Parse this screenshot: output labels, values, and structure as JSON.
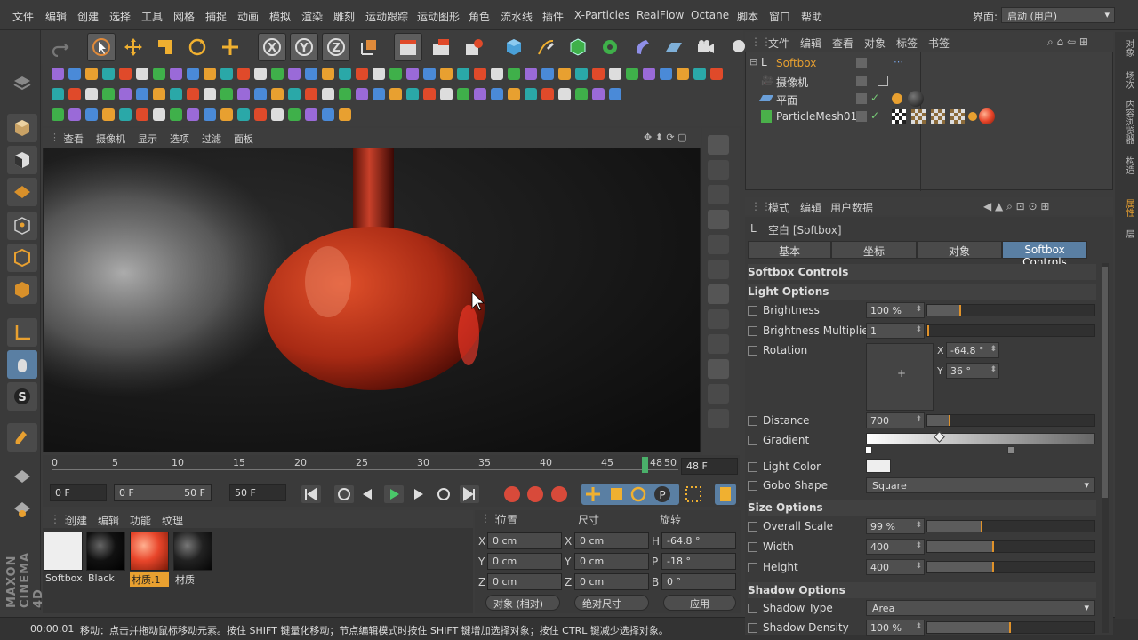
{
  "menu": [
    "文件",
    "编辑",
    "创建",
    "选择",
    "工具",
    "网格",
    "捕捉",
    "动画",
    "模拟",
    "渲染",
    "雕刻",
    "运动跟踪",
    "运动图形",
    "角色",
    "流水线",
    "插件",
    "X-Particles",
    "RealFlow",
    "Octane",
    "脚本",
    "窗口",
    "帮助"
  ],
  "layout": {
    "label": "界面:",
    "value": "启动 (用户)"
  },
  "viewport": {
    "menu": [
      "查看",
      "摄像机",
      "显示",
      "选项",
      "过滤",
      "面板"
    ]
  },
  "timeline": {
    "ticks": [
      "0",
      "5",
      "10",
      "15",
      "20",
      "25",
      "30",
      "35",
      "40",
      "45",
      "48",
      "50"
    ],
    "current": "48 F"
  },
  "transport": {
    "start": "0 F",
    "range_start": "0 F",
    "range_end": "50 F",
    "end": "50 F"
  },
  "materials": {
    "menu": [
      "创建",
      "编辑",
      "功能",
      "纹理"
    ],
    "items": [
      {
        "name": "Softbox",
        "color": "#eeeeee"
      },
      {
        "name": "Black",
        "color": "#111111"
      },
      {
        "name": "材质.1",
        "color": "#e8452a"
      },
      {
        "name": "材质",
        "color": "#222222"
      }
    ]
  },
  "coords": {
    "headers": [
      "位置",
      "尺寸",
      "旋转"
    ],
    "rows": [
      {
        "a": "X",
        "pos": "0 cm",
        "b": "X",
        "size": "0 cm",
        "c": "H",
        "rot": "-64.8 °"
      },
      {
        "a": "Y",
        "pos": "0 cm",
        "b": "Y",
        "size": "0 cm",
        "c": "P",
        "rot": "-18 °"
      },
      {
        "a": "Z",
        "pos": "0 cm",
        "b": "Z",
        "size": "0 cm",
        "c": "B",
        "rot": "0 °"
      }
    ],
    "mode": "对象 (相对)",
    "size_mode": "绝对尺寸",
    "apply": "应用"
  },
  "status": {
    "time": "00:00:01",
    "message": "移动：点击并拖动鼠标移动元素。按住 SHIFT 键量化移动；节点编辑模式时按住 SHIFT 键增加选择对象；按住 CTRL 键减少选择对象。"
  },
  "objects": {
    "menu": [
      "文件",
      "编辑",
      "查看",
      "对象",
      "标签",
      "书签"
    ],
    "items": [
      {
        "name": "Softbox",
        "highlight": true
      },
      {
        "name": "摄像机",
        "highlight": false
      },
      {
        "name": "平面",
        "highlight": false
      },
      {
        "name": "ParticleMesh01",
        "highlight": false
      }
    ]
  },
  "attributes": {
    "menu": [
      "模式",
      "编辑",
      "用户数据"
    ],
    "title": "空白 [Softbox]",
    "tabs": [
      "基本",
      "坐标",
      "对象",
      "Softbox Controls"
    ],
    "section_main": "Softbox Controls",
    "light_options": "Light Options",
    "brightness": {
      "label": "Brightness",
      "value": "100 %",
      "level": 0.2
    },
    "brightness_mult": {
      "label": "Brightness Multiplier",
      "value": "1",
      "level": 0.01
    },
    "rotation": {
      "label": "Rotation",
      "x": "-64.8 °",
      "y": "36 °"
    },
    "distance": {
      "label": "Distance",
      "value": "700",
      "level": 0.14
    },
    "gradient": {
      "label": "Gradient"
    },
    "light_color": {
      "label": "Light Color"
    },
    "gobo": {
      "label": "Gobo Shape",
      "value": "Square"
    },
    "size_options": "Size Options",
    "overall_scale": {
      "label": "Overall Scale",
      "value": "99 %",
      "level": 0.33
    },
    "width": {
      "label": "Width",
      "value": "400",
      "level": 0.4
    },
    "height": {
      "label": "Height",
      "value": "400",
      "level": 0.4
    },
    "shadow_options": "Shadow Options",
    "shadow_type": {
      "label": "Shadow Type",
      "value": "Area"
    },
    "shadow_density": {
      "label": "Shadow Density",
      "value": "100 %",
      "level": 0.5
    }
  },
  "side_tabs": [
    "对象",
    "场次",
    "内容浏览器",
    "构造",
    "属性",
    "层"
  ],
  "brand": "MAXON CINEMA 4D"
}
